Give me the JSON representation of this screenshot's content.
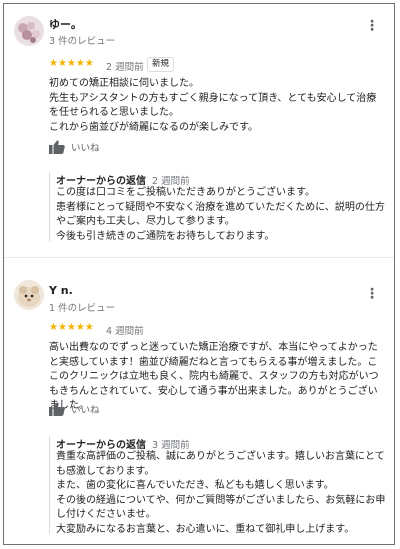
{
  "reviews": [
    {
      "author": "ゆー。",
      "count": "3 件のレビュー",
      "stars": "★★★★★",
      "time": "2 週間前",
      "badge": "新規",
      "text": "初めての矯正相談に伺いました。\n先生もアシスタントの方もすごく親身になって頂き、とても安心して治療を任せられると思いました。\nこれから歯並びが綺麗になるのが楽しみです。",
      "like_label": "いいね",
      "owner_title": "オーナーからの返信",
      "owner_time": "2 週間前",
      "owner_text": "この度は口コミをご投稿いただきありがとうございます。\n患者様にとって疑問や不安なく治療を進めていただくために、説明の仕方やご案内も工夫し、尽力して参ります。\n今後も引き続きのご通院をお待ちしております。"
    },
    {
      "author": "Y n.",
      "count": "1 件のレビュー",
      "stars": "★★★★★",
      "time": "4 週間前",
      "text": "高い出費なのでずっと迷っていた矯正治療ですが、本当にやってよかったと実感しています！歯並び綺麗だねと言ってもらえる事が増えました。ここのクリニックは立地も良く、院内も綺麗で、スタッフの方も対応がいつもきちんとされていて、安心して通う事が出来ました。ありがとうございました。",
      "like_label": "いいね",
      "owner_title": "オーナーからの返信",
      "owner_time": "3 週間前",
      "owner_text": "貴重な高評価のご投稿、誠にありがとうございます。嬉しいお言葉にとても感激しております。\nまた、歯の変化に喜んでいただき、私どもも嬉しく思います。\nその後の経過についてや、何かご質問等がございましたら、お気軽にお申し付けくださいませ。\n大変励みになるお言葉と、お心遣いに、重ねて御礼申し上げます。"
    }
  ],
  "colors": {
    "star": "#f4b400",
    "text": "#202124",
    "meta": "#70757a"
  }
}
